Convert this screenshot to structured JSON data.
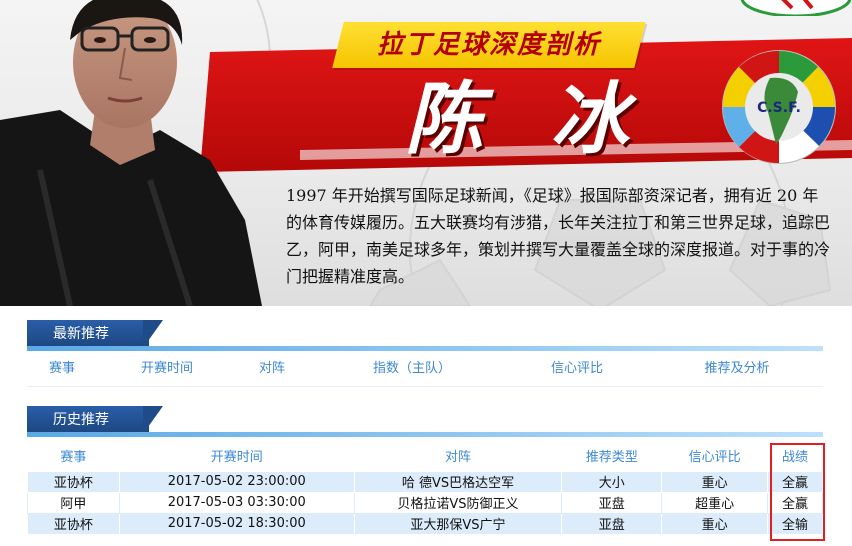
{
  "banner": {
    "tagline": "拉丁足球深度剖析",
    "expert_name": "陈 冰",
    "bio": "1997 年开始撰写国际足球新闻，《足球》报国际部资深记者，拥有近 20 年的体育传媒履历。五大联赛均有涉猎，长年关注拉丁和第三世界足球，追踪巴乙，阿甲，南美足球多年，策划并撰写大量覆盖全球的深度报道。对于事的冷门把握精准度高。",
    "logo_text": "C.S.F.",
    "colors": {
      "red": "#d20a0a",
      "yellow": "#f5c400",
      "blue": "#1f4b88"
    }
  },
  "latest": {
    "title": "最新推荐",
    "columns": [
      "赛事",
      "开赛时间",
      "对阵",
      "指数（主队）",
      "信心评比",
      "推荐及分析"
    ]
  },
  "history": {
    "title": "历史推荐",
    "columns": [
      "赛事",
      "开赛时间",
      "对阵",
      "推荐类型",
      "信心评比",
      "战绩"
    ],
    "rows": [
      {
        "league": "亚协杯",
        "time": "2017-05-02 23:00:00",
        "match": "哈 德VS巴格达空军",
        "type": "大小",
        "confidence": "重心",
        "result": "全赢"
      },
      {
        "league": "阿甲",
        "time": "2017-05-03 03:30:00",
        "match": "贝格拉诺VS防御正义",
        "type": "亚盘",
        "confidence": "超重心",
        "result": "全赢"
      },
      {
        "league": "亚协杯",
        "time": "2017-05-02 18:30:00",
        "match": "亚大那保VS广宁",
        "type": "亚盘",
        "confidence": "重心",
        "result": "全输"
      }
    ]
  }
}
